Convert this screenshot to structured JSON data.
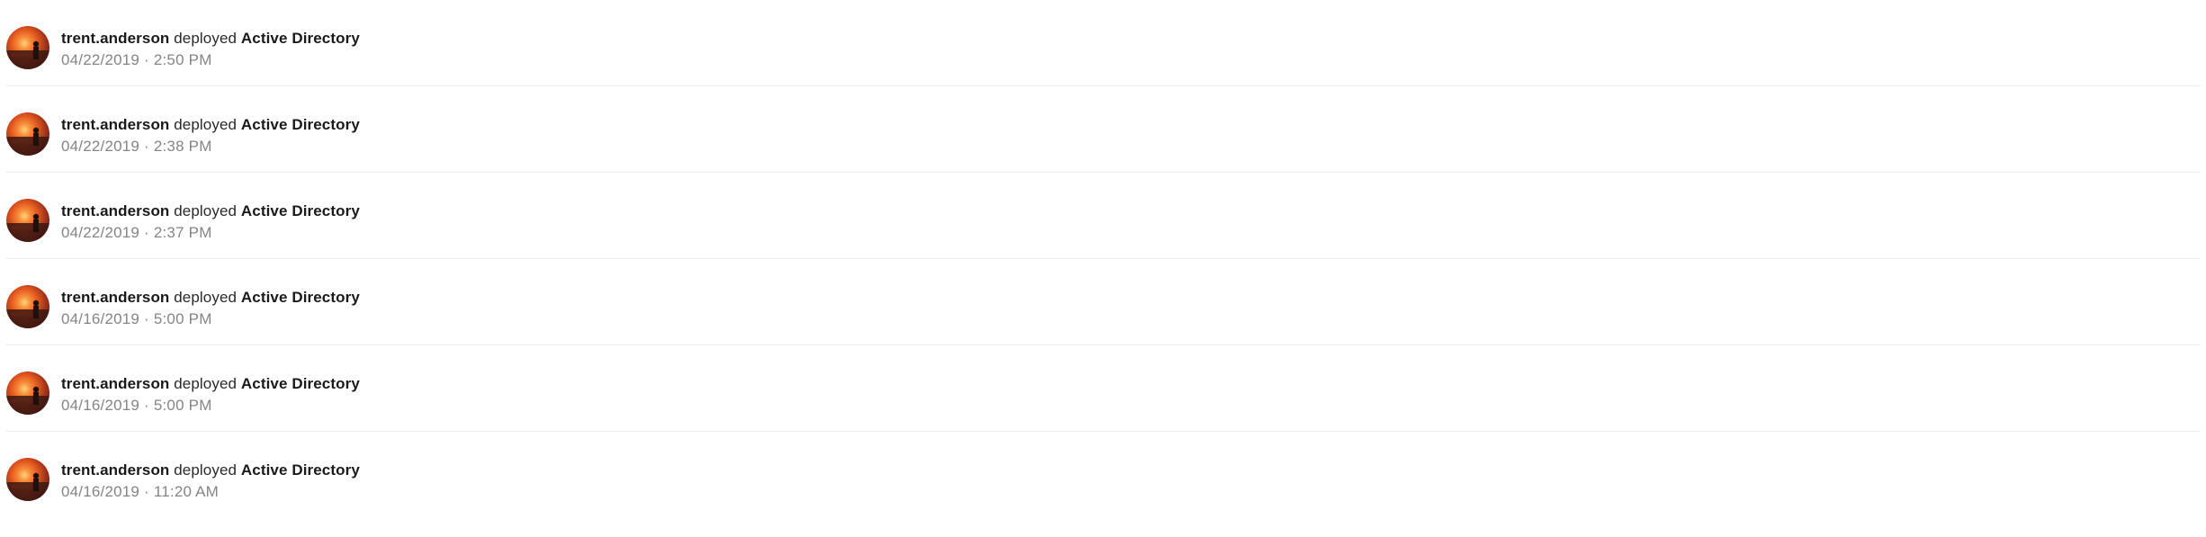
{
  "activity_feed": {
    "entries": [
      {
        "user": "trent.anderson",
        "action": "deployed",
        "target": "Active Directory",
        "date": "04/22/2019",
        "separator": "·",
        "time": "2:50 PM"
      },
      {
        "user": "trent.anderson",
        "action": "deployed",
        "target": "Active Directory",
        "date": "04/22/2019",
        "separator": "·",
        "time": "2:38 PM"
      },
      {
        "user": "trent.anderson",
        "action": "deployed",
        "target": "Active Directory",
        "date": "04/22/2019",
        "separator": "·",
        "time": "2:37 PM"
      },
      {
        "user": "trent.anderson",
        "action": "deployed",
        "target": "Active Directory",
        "date": "04/16/2019",
        "separator": "·",
        "time": "5:00 PM"
      },
      {
        "user": "trent.anderson",
        "action": "deployed",
        "target": "Active Directory",
        "date": "04/16/2019",
        "separator": "·",
        "time": "5:00 PM"
      },
      {
        "user": "trent.anderson",
        "action": "deployed",
        "target": "Active Directory",
        "date": "04/16/2019",
        "separator": "·",
        "time": "11:20 AM"
      }
    ]
  },
  "icons": {
    "avatar": "user-avatar-sunset-photo"
  }
}
